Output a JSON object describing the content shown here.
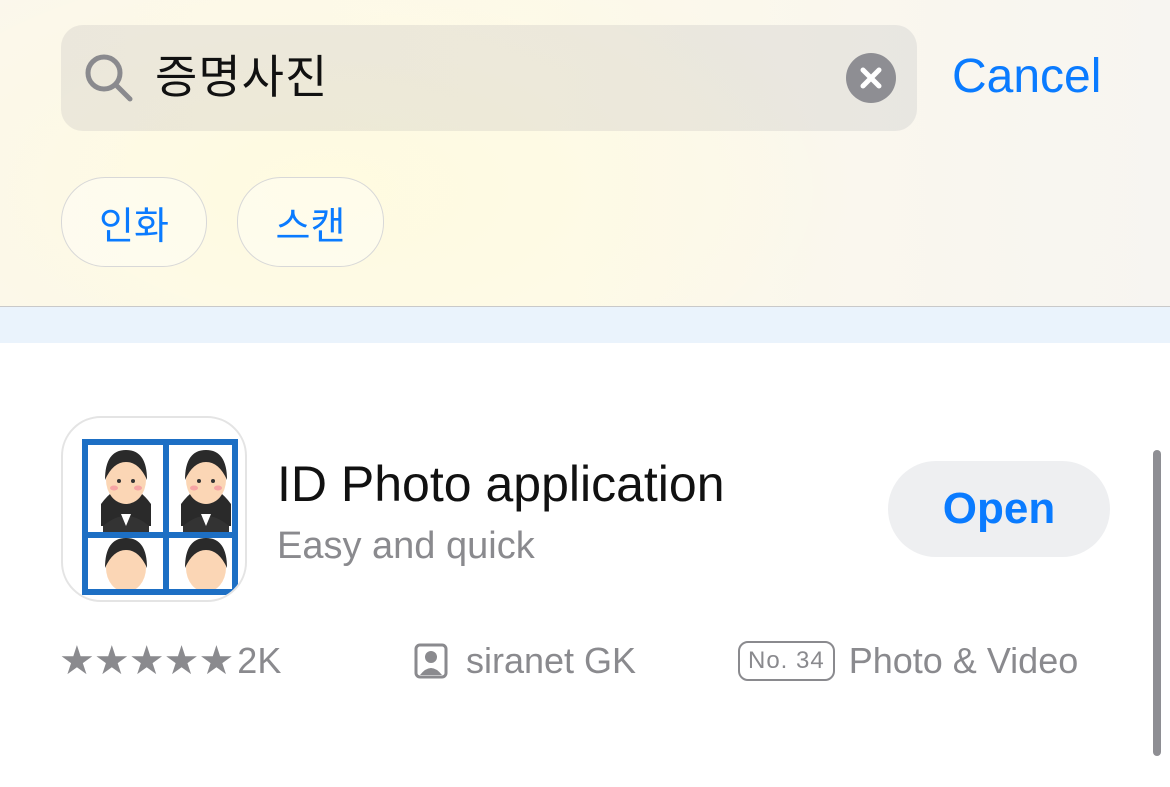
{
  "search": {
    "query": "증명사진",
    "cancel_label": "Cancel"
  },
  "suggestions": [
    "인화",
    "스캔"
  ],
  "app": {
    "name": "ID Photo application",
    "subtitle": "Easy and quick",
    "action_label": "Open",
    "rating_stars": 5,
    "rating_count": "2K",
    "developer": "siranet GK",
    "rank": "No. 34",
    "category": "Photo & Video"
  },
  "icons": {
    "search": "search-icon",
    "clear": "clear-icon",
    "star": "star-icon",
    "developer": "person-icon"
  },
  "colors": {
    "accent": "#0a7bff",
    "secondary_text": "#8a8a8e",
    "button_bg": "#eeeff1",
    "band": "#eaf3fc"
  }
}
